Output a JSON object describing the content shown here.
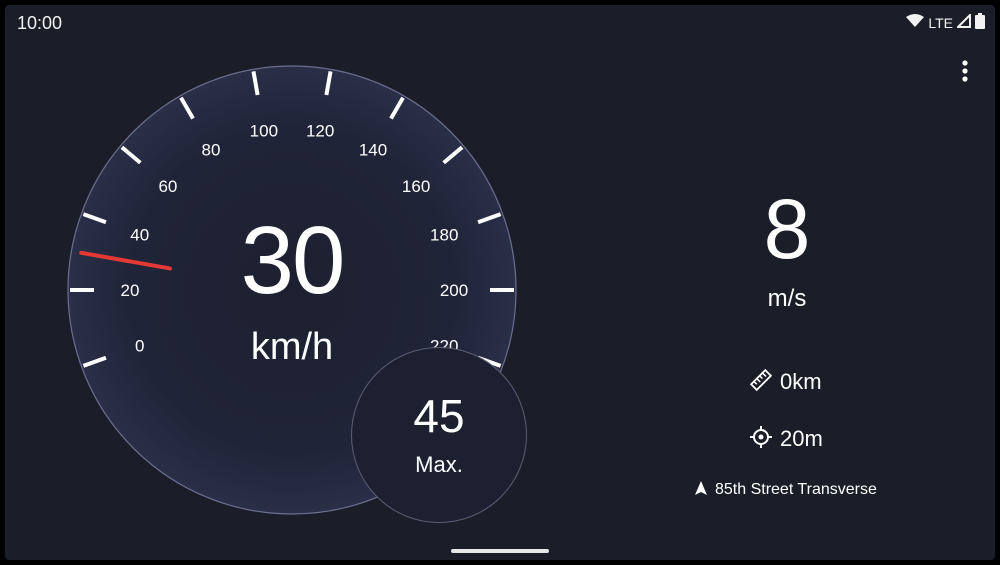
{
  "status_bar": {
    "time": "10:00",
    "network": "LTE"
  },
  "speedometer": {
    "current_speed": "30",
    "unit": "km/h",
    "needle_value_kmh": 30,
    "tick_labels": [
      "0",
      "20",
      "40",
      "60",
      "80",
      "100",
      "120",
      "140",
      "160",
      "180",
      "200",
      "220"
    ],
    "max_speed": "45",
    "max_label": "Max."
  },
  "stats": {
    "speed_ms": "8",
    "speed_ms_unit": "m/s",
    "distance": "0km",
    "accuracy": "20m",
    "street": "85th Street Transverse"
  },
  "colors": {
    "background": "#1b1d28",
    "needle": "#e53935",
    "text": "#ffffff"
  },
  "icons": {
    "menu": "more-vert-icon",
    "distance": "ruler-icon",
    "accuracy": "crosshair-icon",
    "street": "navigation-arrow-icon"
  }
}
